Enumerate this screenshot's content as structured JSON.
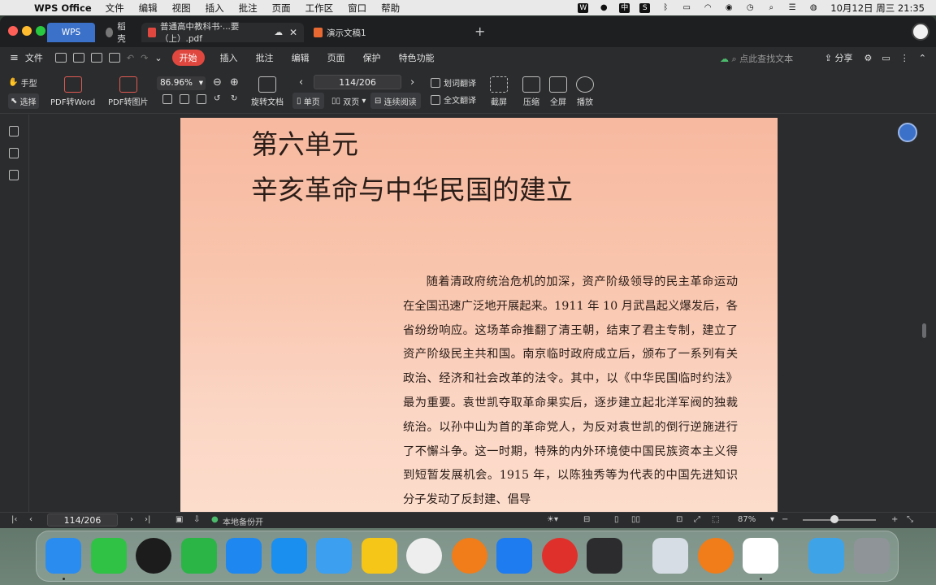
{
  "menubar": {
    "app_name": "WPS Office",
    "items": [
      "文件",
      "编辑",
      "视图",
      "插入",
      "批注",
      "页面",
      "工作区",
      "窗口",
      "帮助"
    ],
    "clock": "10月12日 周三 21:35"
  },
  "tabs": {
    "home": "WPS",
    "t1": "稻壳",
    "t2": "普通高中教科书·...要（上）.pdf",
    "t3": "演示文稿1"
  },
  "menu": {
    "file": "文件",
    "start": "开始",
    "insert": "插入",
    "annotate": "批注",
    "edit": "编辑",
    "page": "页面",
    "protect": "保护",
    "features": "特色功能",
    "search": "点此查找文本",
    "share": "分享"
  },
  "toolbar": {
    "hand": "手型",
    "select": "选择",
    "pdf_word": "PDF转Word",
    "pdf_img": "PDF转图片",
    "zoom": "86.96%",
    "rotate": "旋转文档",
    "page": "114/206",
    "single": "单页",
    "double": "双页",
    "continuous": "连续阅读",
    "word_trans": "划词翻译",
    "full_trans": "全文翻译",
    "screenshot": "截屏",
    "compress": "压缩",
    "fullscreen": "全屏",
    "play": "播放"
  },
  "document": {
    "unit": "第六单元",
    "title": "辛亥革命与中华民国的建立",
    "paragraph": "随着清政府统治危机的加深，资产阶级领导的民主革命运动在全国迅速广泛地开展起来。1911 年 10 月武昌起义爆发后，各省纷纷响应。这场革命推翻了清王朝，结束了君主专制，建立了资产阶级民主共和国。南京临时政府成立后，颁布了一系列有关政治、经济和社会改革的法令。其中，以《中华民国临时约法》最为重要。袁世凯夺取革命果实后，逐步建立起北洋军阀的独裁统治。以孙中山为首的革命党人，为反对袁世凯的倒行逆施进行了不懈斗争。这一时期，特殊的内外环境使中国民族资本主义得到短暂发展机会。1915 年，以陈独秀等为代表的中国先进知识分子发动了反封建、倡导"
  },
  "status": {
    "page": "114/206",
    "backup": "本地备份开",
    "zoom": "87%"
  },
  "colors": {
    "accent": "#3b71c9",
    "start": "#e0483f",
    "page_bg": "#f9c5ad"
  }
}
